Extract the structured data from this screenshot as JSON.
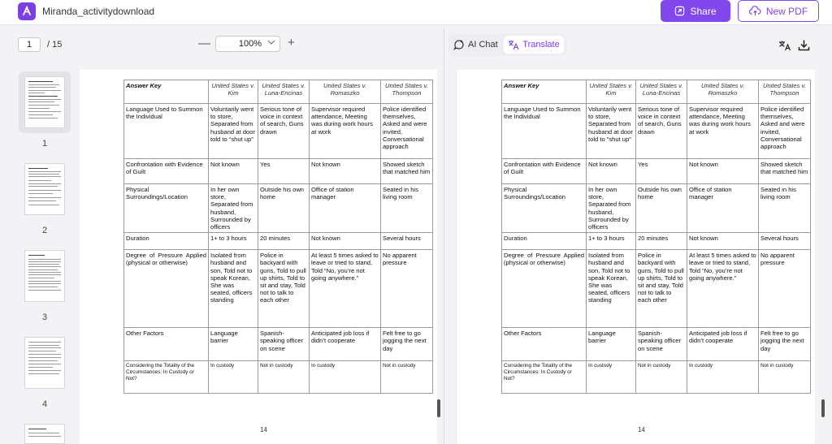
{
  "app": {
    "doc_name": "Miranda_activitydownload",
    "share_label": "Share",
    "new_pdf_label": "New PDF"
  },
  "toolbar": {
    "current_page": "1",
    "total_pages": "/ 15",
    "zoom": "100%",
    "zoom_minus": "—",
    "zoom_plus": "+",
    "ai_chat_label": "AI Chat",
    "translate_label": "Translate"
  },
  "thumbnails": [
    "1",
    "2",
    "3",
    "4"
  ],
  "table": {
    "headers": [
      "Answer Key",
      "United States v. Kim",
      "United States v. Luna-Encinas",
      "United States v. Romaszko",
      "United States v. Thompson"
    ],
    "rows": [
      [
        "Language Used to Summon the Individual",
        "Voluntarily went to store, Separated from husband at door told to “shut up”",
        "Serious tone of voice in context of search, Guns drawn",
        "Supervisor required attendance, Meeting was during work hours at work",
        "Police identified themselves, Asked and were invited, Conversational approach"
      ],
      [
        "Confrontation with Evidence of Guilt",
        "Not known",
        "Yes",
        "Not known",
        "Showed sketch that matched him"
      ],
      [
        "Physical Surroundings/Location",
        "In her own store, Separated from husband, Surrounded by officers",
        "Outside his own home",
        "Office of station manager",
        "Seated in his living room"
      ],
      [
        "Duration",
        "1+ to 3 hours",
        "20 minutes",
        "Not known",
        "Several hours"
      ],
      [
        "Degree of Pressure Applied (physical or otherwise)",
        "Isolated from husband and son, Told not to speak Korean, She was seated, officers standing",
        "Police in backyard with guns, Told to pull up shirts, Told to sit and stay, Told not to talk to each other",
        "At least 5 times asked to leave or tried to stand, Told “No, you’re not going anywhere.”",
        "No apparent pressure"
      ],
      [
        "Other Factors",
        "Language barrier",
        "Spanish-speaking officer on scene",
        "Anticipated job loss if didn’t cooperate",
        "Felt free to go jogging the next day"
      ],
      [
        "Considering the Totality of the Circumstances: In Custody or Not?",
        "In custody",
        "Not in custody",
        "In custody",
        "Not in custody"
      ]
    ],
    "page_number": "14"
  }
}
